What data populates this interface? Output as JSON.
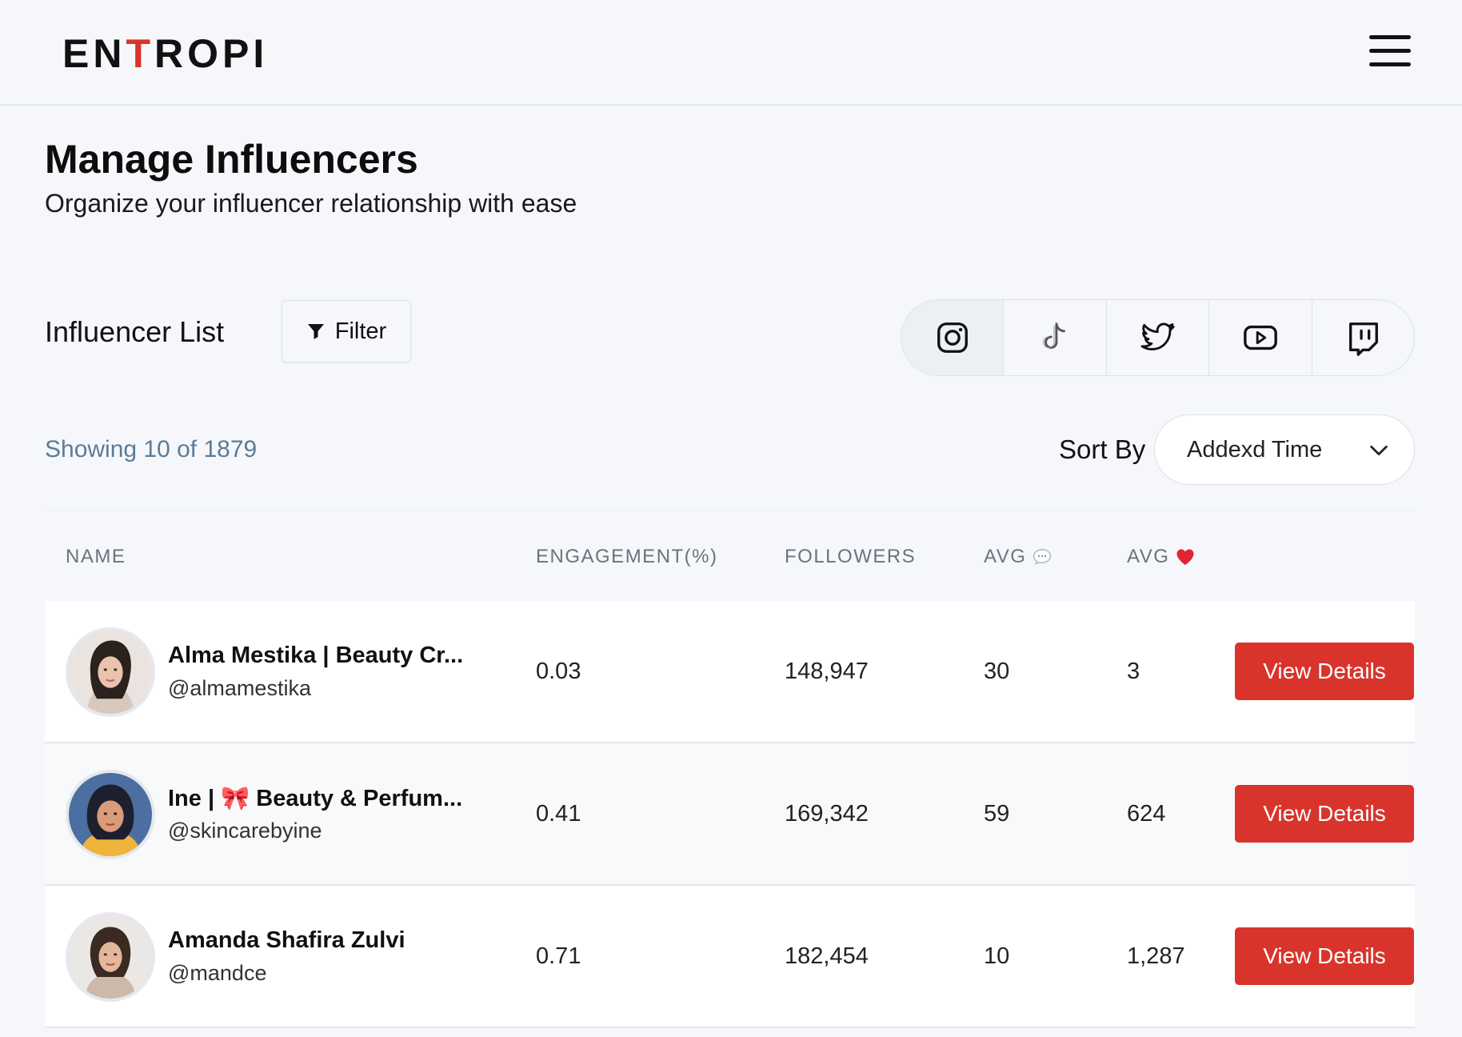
{
  "header": {
    "logo_pre": "EN",
    "logo_accent": "T",
    "logo_post": "ROPI"
  },
  "page": {
    "title": "Manage Influencers",
    "subtitle": "Organize your influencer relationship with ease"
  },
  "list": {
    "title": "Influencer List",
    "filter_label": "Filter",
    "showing_text": "Showing 10 of 1879",
    "sort_label": "Sort By",
    "sort_value": "Addexd Time",
    "platforms": [
      "instagram-icon",
      "tiktok-icon",
      "twitter-icon",
      "youtube-icon",
      "twitch-icon"
    ],
    "selected_platform": "instagram-icon"
  },
  "table": {
    "columns": {
      "name": "NAME",
      "engagement": "ENGAGEMENT(%)",
      "followers": "FOLLOWERS",
      "avg_comments": "AVG",
      "avg_likes": "AVG"
    },
    "rows": [
      {
        "name": "Alma Mestika | Beauty Cr...",
        "handle": "@almamestika",
        "engagement": "0.03",
        "followers": "148,947",
        "avg_comments": "30",
        "avg_likes": "3",
        "action": "View Details"
      },
      {
        "name": "Ine | 🎀 Beauty & Perfum...",
        "handle": "@skincarebyine",
        "engagement": "0.41",
        "followers": "169,342",
        "avg_comments": "59",
        "avg_likes": "624",
        "action": "View Details"
      },
      {
        "name": "Amanda Shafira Zulvi",
        "handle": "@mandce",
        "engagement": "0.71",
        "followers": "182,454",
        "avg_comments": "10",
        "avg_likes": "1,287",
        "action": "View Details"
      }
    ]
  },
  "colors": {
    "accent": "#d9342b",
    "background": "#f5f7fa",
    "muted_blue": "#5b7c98"
  }
}
